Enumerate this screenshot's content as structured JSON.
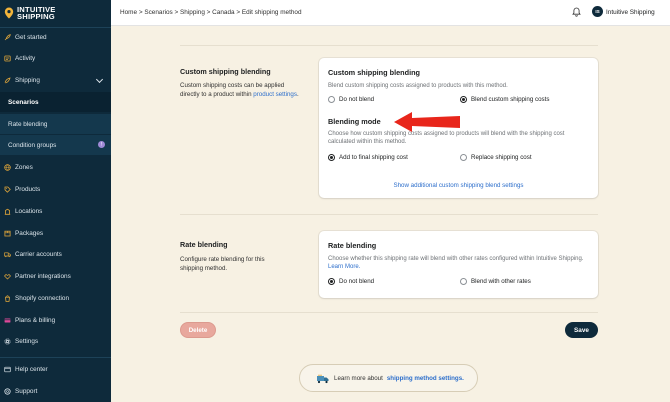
{
  "brand": {
    "line1": "INTUITIVE",
    "line2": "SHIPPING"
  },
  "sidebar": {
    "items": [
      {
        "label": "Get started",
        "icon": "rocket-icon"
      },
      {
        "label": "Activity",
        "icon": "activity-icon"
      },
      {
        "label": "Shipping",
        "icon": "shipping-icon"
      },
      {
        "label": "Scenarios"
      },
      {
        "label": "Rate blending"
      },
      {
        "label": "Condition groups"
      },
      {
        "label": "Zones",
        "icon": "globe-icon"
      },
      {
        "label": "Products",
        "icon": "tag-icon"
      },
      {
        "label": "Locations",
        "icon": "building-icon"
      },
      {
        "label": "Packages",
        "icon": "package-icon"
      },
      {
        "label": "Carrier accounts",
        "icon": "truck-icon"
      },
      {
        "label": "Partner integrations",
        "icon": "handshake-icon"
      },
      {
        "label": "Shopify connection",
        "icon": "shopify-icon"
      },
      {
        "label": "Plans & billing",
        "icon": "credit-card-icon"
      },
      {
        "label": "Settings",
        "icon": "gear-icon"
      },
      {
        "label": "Help center",
        "icon": "help-icon"
      },
      {
        "label": "Support",
        "icon": "support-icon"
      }
    ],
    "badge": "!"
  },
  "topbar": {
    "breadcrumb": "Home > Scenarios > Shipping > Canada > Edit shipping method",
    "avatar_initials": "IS",
    "user_name": "Intuitive Shipping"
  },
  "custom_blending": {
    "section_title": "Custom shipping blending",
    "section_desc": "Custom shipping costs can be applied directly to a product within",
    "section_link": "product settings",
    "card_title": "Custom shipping blending",
    "card_sub": "Blend custom shipping costs assigned to products with this method.",
    "opt_no": "Do not blend",
    "opt_yes": "Blend custom shipping costs",
    "mode_title": "Blending mode",
    "mode_sub": "Choose how custom shipping costs assigned to products will blend with the shipping cost calculated within this method.",
    "mode_add": "Add to final shipping cost",
    "mode_replace": "Replace shipping cost",
    "show_more": "Show additional custom shipping blend settings"
  },
  "rate_blending": {
    "section_title": "Rate blending",
    "section_desc": "Configure rate blending for this shipping method.",
    "card_title": "Rate blending",
    "card_sub": "Choose whether this shipping rate will blend with other rates configured within Intuitive Shipping.",
    "card_link": "Learn More.",
    "opt_no": "Do not blend",
    "opt_yes": "Blend with other rates"
  },
  "actions": {
    "delete": "Delete",
    "save": "Save"
  },
  "learn_more": {
    "text": "Learn more about",
    "link": "shipping method settings."
  },
  "colors": {
    "sidebar": "#0e2a3b",
    "accent": "#e0a63a",
    "page": "#f7f1e3",
    "link": "#2c6ecb",
    "arrow": "#e8261b",
    "delete": "#e8a89d"
  }
}
